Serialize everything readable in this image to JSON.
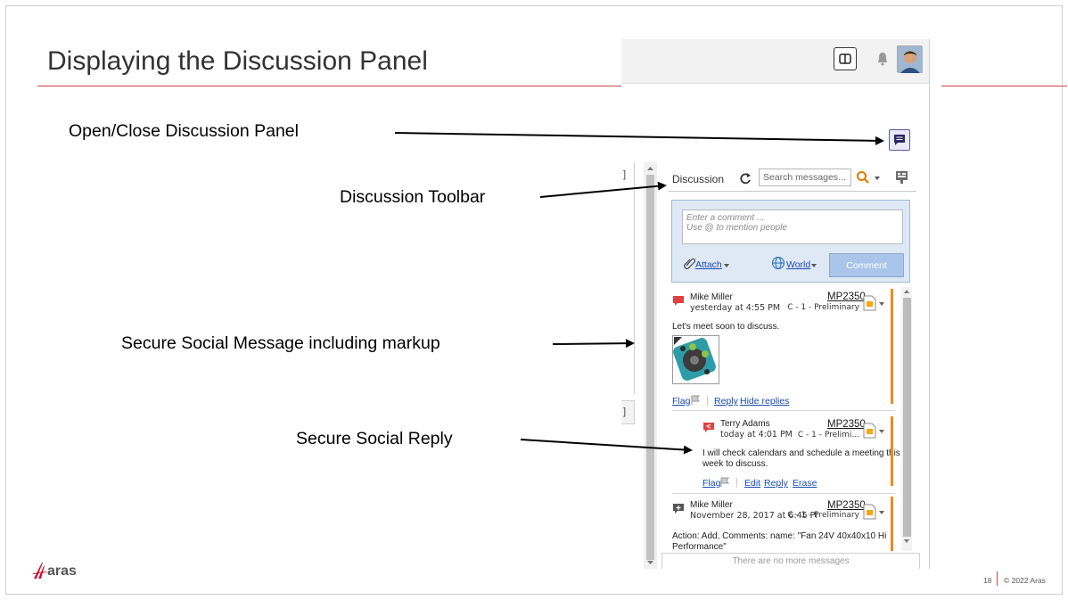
{
  "slide": {
    "title": "Displaying the Discussion Panel",
    "page_number": "18",
    "copyright": "© 2022 Aras",
    "logo_text": "aras"
  },
  "callouts": {
    "open_close": "Open/Close Discussion Panel",
    "toolbar": "Discussion Toolbar",
    "secure_message": "Secure Social Message including markup",
    "secure_reply": "Secure Social Reply"
  },
  "discussion": {
    "title": "Discussion",
    "search_placeholder": "Search messages...",
    "compose_placeholder_1": "Enter a comment ...",
    "compose_placeholder_2": "Use @ to mention people",
    "attach_label": "Attach",
    "world_label": "World",
    "comment_button": "Comment",
    "no_more": "There are no more messages"
  },
  "messages": [
    {
      "author": "Mike Miller",
      "time": "yesterday at 4:55 PM",
      "item": "MP2350",
      "item_state": "C - 1 - Preliminary",
      "text": "Let's meet soon to discuss.",
      "actions": {
        "flag": "Flag",
        "reply": "Reply",
        "hide": "Hide replies"
      }
    },
    {
      "author": "Terry Adams",
      "time": "today at 4:01 PM",
      "item": "MP2350",
      "item_state": "C - 1 - Prelimi...",
      "text_1": "I will check calendars and schedule a meeting this",
      "text_2": "week to discuss.",
      "actions": {
        "flag": "Flag",
        "edit": "Edit",
        "reply": "Reply",
        "erase": "Erase"
      }
    },
    {
      "author": "Mike Miller",
      "time": "November 28, 2017 at 6:45 Pl",
      "item": "MP2350",
      "item_state": "C - 1 - Preliminary",
      "text_1": "Action: Add, Comments: name: \"Fan 24V 40x40x10 Hi",
      "text_2": "Performance\""
    }
  ],
  "colors": {
    "accent_red": "#cc4444",
    "orange": "#f08a1c",
    "link_blue": "#1a4bb3"
  }
}
